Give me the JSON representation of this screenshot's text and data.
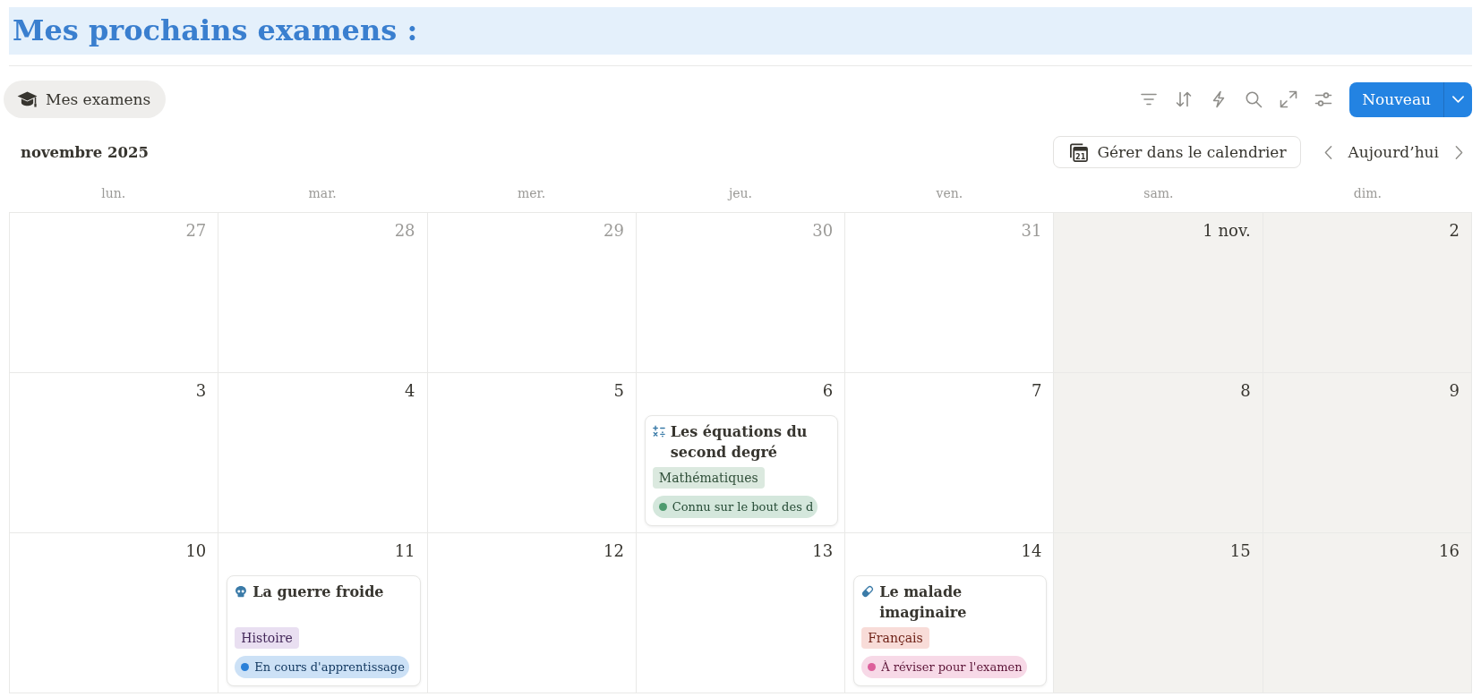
{
  "page": {
    "title": "Mes prochains examens :"
  },
  "views": [
    {
      "label": "Mes examens",
      "selected": true
    }
  ],
  "toolbar": {
    "new_button": "Nouveau"
  },
  "calendar": {
    "month": "novembre 2025",
    "manage_button": {
      "label": "Gérer dans le calendrier",
      "icon_text": "21"
    },
    "today_button": "Aujourd’hui",
    "weekdays": [
      {
        "label": "lun.",
        "weekend": false
      },
      {
        "label": "mar.",
        "weekend": false
      },
      {
        "label": "mer.",
        "weekend": false
      },
      {
        "label": "jeu.",
        "weekend": false
      },
      {
        "label": "ven.",
        "weekend": false
      },
      {
        "label": "sam.",
        "weekend": true
      },
      {
        "label": "dim.",
        "weekend": true
      }
    ],
    "weeks": [
      [
        {
          "day": "27",
          "in_month": false
        },
        {
          "day": "28",
          "in_month": false
        },
        {
          "day": "29",
          "in_month": false
        },
        {
          "day": "30",
          "in_month": false
        },
        {
          "day": "31",
          "in_month": false
        },
        {
          "day": "1 nov.",
          "in_month": true
        },
        {
          "day": "2",
          "in_month": true
        }
      ],
      [
        {
          "day": "3",
          "in_month": true
        },
        {
          "day": "4",
          "in_month": true
        },
        {
          "day": "5",
          "in_month": true
        },
        {
          "day": "6",
          "in_month": true,
          "events": [
            {
              "kind": "maths",
              "title": "Les équations du second degré",
              "tag": {
                "label": "Mathématiques",
                "color": "#dbe9df"
              },
              "status": {
                "label": "Connu sur le bout des d",
                "color": "#4d9a6e"
              }
            }
          ]
        },
        {
          "day": "7",
          "in_month": true
        },
        {
          "day": "8",
          "in_month": true
        },
        {
          "day": "9",
          "in_month": true
        }
      ],
      [
        {
          "day": "10",
          "in_month": true
        },
        {
          "day": "11",
          "in_month": true,
          "events": [
            {
              "kind": "histoire",
              "title": "La guerre froide",
              "tag": {
                "label": "Histoire",
                "color": "#e9dff1"
              },
              "status": {
                "label": "En cours d'apprentissage",
                "color": "#2b80d8"
              }
            }
          ]
        },
        {
          "day": "12",
          "in_month": true
        },
        {
          "day": "13",
          "in_month": true
        },
        {
          "day": "14",
          "in_month": true,
          "events": [
            {
              "kind": "francais",
              "title": "Le malade imaginaire",
              "tag": {
                "label": "Français",
                "color": "#f8dcd8"
              },
              "status": {
                "label": "À réviser pour l'examen",
                "color": "#dc5f9b"
              }
            }
          ]
        },
        {
          "day": "15",
          "in_month": true
        },
        {
          "day": "16",
          "in_month": true
        }
      ]
    ]
  }
}
